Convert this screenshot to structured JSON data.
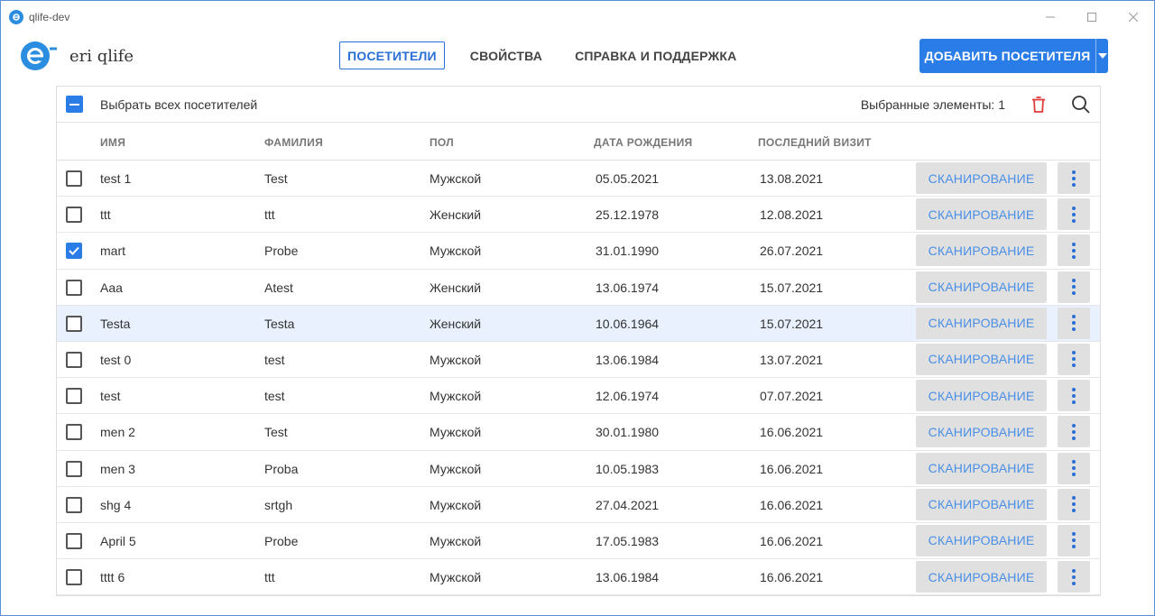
{
  "window": {
    "title": "qlife-dev"
  },
  "header": {
    "brand": "eri qlife",
    "nav": [
      "ПОСЕТИТЕЛИ",
      "СВОЙСТВА",
      "СПРАВКА И ПОДДЕРЖКА"
    ],
    "active_tab": "ПОСЕТИТЕЛИ",
    "add_button": "ДОБАВИТЬ ПОСЕТИТЕЛЯ"
  },
  "toolbar": {
    "select_all_label": "Выбрать всех посетителей",
    "selected_count": "Выбранные элементы: 1"
  },
  "table": {
    "columns": [
      "ИМЯ",
      "ФАМИЛИЯ",
      "ПОЛ",
      "ДАТА РОЖДЕНИЯ",
      "ПОСЛЕДНИЙ ВИЗИТ"
    ],
    "scan_label": "СКАНИРОВАНИЕ",
    "rows": [
      {
        "first": "test 1",
        "last": "Test",
        "gender": "Мужской",
        "birth": "05.05.2021",
        "visit": "13.08.2021",
        "checked": false
      },
      {
        "first": "ttt",
        "last": "ttt",
        "gender": "Женский",
        "birth": "25.12.1978",
        "visit": "12.08.2021",
        "checked": false
      },
      {
        "first": "mart",
        "last": "Probe",
        "gender": "Мужской",
        "birth": "31.01.1990",
        "visit": "26.07.2021",
        "checked": true
      },
      {
        "first": "Aaa",
        "last": "Atest",
        "gender": "Женский",
        "birth": "13.06.1974",
        "visit": "15.07.2021",
        "checked": false
      },
      {
        "first": "Testa",
        "last": "Testa",
        "gender": "Женский",
        "birth": "10.06.1964",
        "visit": "15.07.2021",
        "checked": false,
        "highlighted": true
      },
      {
        "first": "test 0",
        "last": "test",
        "gender": "Мужской",
        "birth": "13.06.1984",
        "visit": "13.07.2021",
        "checked": false
      },
      {
        "first": "test",
        "last": "test",
        "gender": "Мужской",
        "birth": "12.06.1974",
        "visit": "07.07.2021",
        "checked": false
      },
      {
        "first": "men 2",
        "last": "Test",
        "gender": "Мужской",
        "birth": "30.01.1980",
        "visit": "16.06.2021",
        "checked": false
      },
      {
        "first": "men 3",
        "last": "Proba",
        "gender": "Мужской",
        "birth": "10.05.1983",
        "visit": "16.06.2021",
        "checked": false
      },
      {
        "first": "shg 4",
        "last": "srtgh",
        "gender": "Мужской",
        "birth": "27.04.2021",
        "visit": "16.06.2021",
        "checked": false
      },
      {
        "first": "April 5",
        "last": "Probe",
        "gender": "Мужской",
        "birth": "17.05.1983",
        "visit": "16.06.2021",
        "checked": false
      },
      {
        "first": "tttt 6",
        "last": "ttt",
        "gender": "Мужской",
        "birth": "13.06.1984",
        "visit": "16.06.2021",
        "checked": false
      }
    ]
  },
  "colors": {
    "accent": "#2a7de6",
    "delete": "#e03b3b",
    "row_highlight": "#e8f1fd"
  },
  "icons": [
    "app-icon",
    "minimize-icon",
    "maximize-icon",
    "close-icon",
    "logo-icon",
    "chevron-down-icon",
    "trash-icon",
    "search-icon",
    "more-vertical-icon",
    "checkmark-icon"
  ]
}
